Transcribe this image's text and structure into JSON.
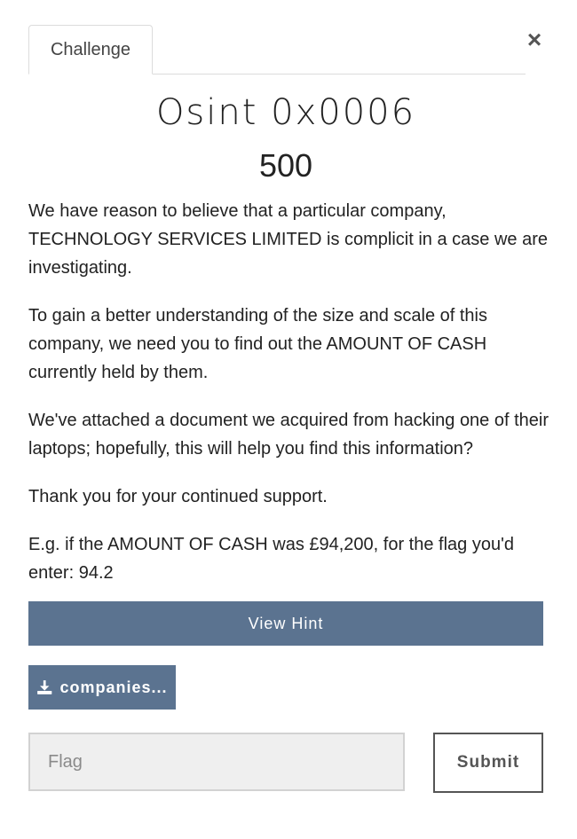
{
  "tabs": [
    {
      "label": "Challenge"
    }
  ],
  "close_glyph": "×",
  "challenge": {
    "title": "Osint 0x0006",
    "points": "500",
    "description": [
      "We have reason to believe that a particular company, TECHNOLOGY SERVICES LIMITED is complicit in a case we are investigating.",
      "To gain a better understanding of the size and scale of this company, we need you to find out the AMOUNT OF CASH currently held by them.",
      "We've attached a document we acquired from hacking one of their laptops; hopefully, this will help you find this information?",
      "Thank you for your continued support.",
      "E.g. if the AMOUNT OF CASH was £94,200, for the flag you'd enter: 94.2"
    ]
  },
  "buttons": {
    "hint_label": "View Hint",
    "file_label": "companies...",
    "file_icon": "download-icon",
    "submit_label": "Submit"
  },
  "flag_input": {
    "placeholder": "Flag",
    "value": ""
  },
  "colors": {
    "button_bg": "#5b7390"
  }
}
